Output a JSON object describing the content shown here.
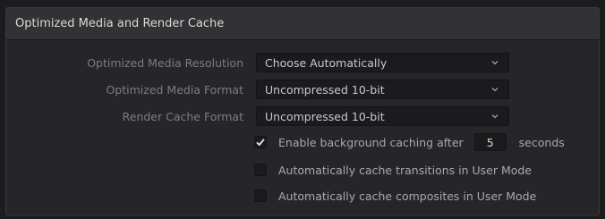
{
  "panel": {
    "title": "Optimized Media and Render Cache"
  },
  "fields": [
    {
      "label": "Optimized Media Resolution",
      "value": "Choose Automatically"
    },
    {
      "label": "Optimized Media Format",
      "value": "Uncompressed 10-bit"
    },
    {
      "label": "Render Cache Format",
      "value": "Uncompressed 10-bit"
    }
  ],
  "options": {
    "background_caching": {
      "label": "Enable background caching after",
      "checked": true,
      "value": "5",
      "unit": "seconds"
    },
    "cache_transitions": {
      "label": "Automatically cache transitions in User Mode",
      "checked": false
    },
    "cache_composites": {
      "label": "Automatically cache composites in User Mode",
      "checked": false
    }
  },
  "icons": {
    "dropdown": "chevron-down-icon",
    "check": "checkmark-icon"
  },
  "colors": {
    "background": "#1c1c1e",
    "panel": "#262628",
    "header": "#323235",
    "field": "#1b1b1d",
    "label_dim": "#7d7d80",
    "text": "#c9c9cb"
  }
}
